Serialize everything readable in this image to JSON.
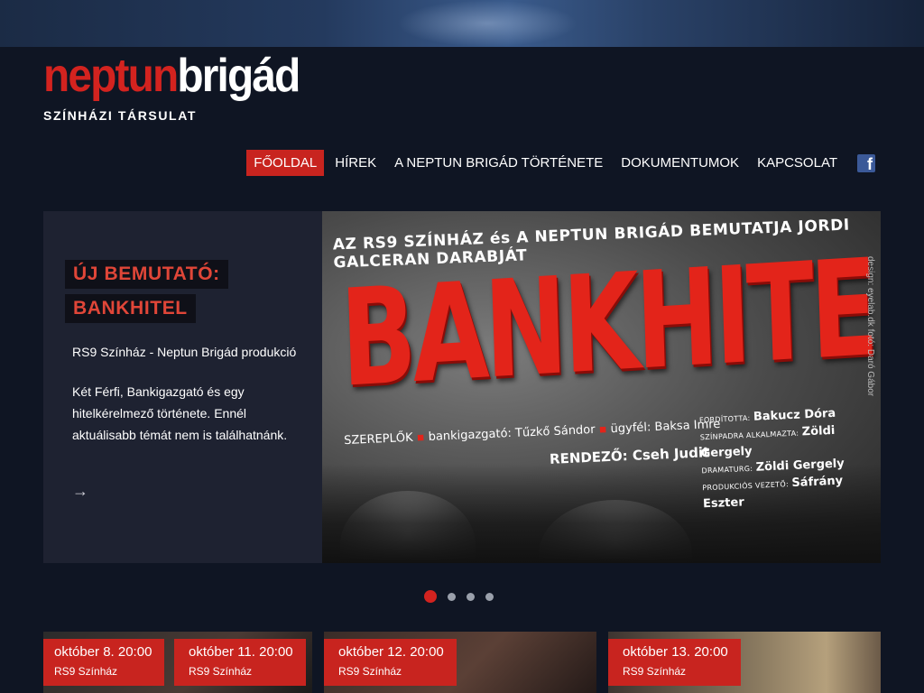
{
  "logo": {
    "part_red": "neptun",
    "part_white": "brigád",
    "tagline": "SZÍNHÁZI TÁRSULAT"
  },
  "nav": {
    "items": [
      {
        "label": "FŐOLDAL",
        "active": true
      },
      {
        "label": "HÍREK",
        "active": false
      },
      {
        "label": "A NEPTUN BRIGÁD TÖRTÉNETE",
        "active": false
      },
      {
        "label": "DOKUMENTUMOK",
        "active": false
      },
      {
        "label": "KAPCSOLAT",
        "active": false
      }
    ],
    "social_icon": "facebook-icon"
  },
  "slide": {
    "title_line1": "ÚJ BEMUTATÓ:",
    "title_line2": "BANKHITEL",
    "paragraph1": "RS9 Színház - Neptun Brigád produkció",
    "paragraph2": "Két Férfi, Bankigazgató és egy hitelkérelmező története. Ennél aktuálisabb témát nem is találhatnánk.",
    "arrow": "→",
    "poster": {
      "top_line": "AZ RS9 SZÍNHÁZ és A NEPTUN BRIGÁD BEMUTATJA JORDI GALCERAN DARABJÁT",
      "big_title": "BANKHITEL",
      "vertical_credit": "design: eyelab.dk fotó: Daró Gábor",
      "cast_label": "SZEREPLŐK",
      "cast_role1": "bankigazgató:",
      "cast_name1": "Tűzkő Sándor",
      "cast_role2": "ügyfél:",
      "cast_name2": "Baksa Imre",
      "director_label": "RENDEZŐ:",
      "director_name": "Cseh Judit",
      "credits": [
        {
          "key": "FORDÍTOTTA:",
          "value": "Bakucz Dóra"
        },
        {
          "key": "SZÍNPADRA ALKALMAZTA:",
          "value": "Zöldi Gergely"
        },
        {
          "key": "DRAMATURG:",
          "value": "Zöldi Gergely"
        },
        {
          "key": "PRODUKCIÓS VEZETŐ:",
          "value": "Sáfrány Eszter"
        }
      ]
    }
  },
  "slider_dots": {
    "count": 4,
    "active_index": 0
  },
  "events": [
    {
      "date": "október 8. 20:00",
      "venue": "RS9 Színház"
    },
    {
      "date": "október 11. 20:00",
      "venue": "RS9 Színház"
    },
    {
      "date": "október 12. 20:00",
      "venue": "RS9 Színház"
    },
    {
      "date": "október 13. 20:00",
      "venue": "RS9 Színház"
    }
  ],
  "colors": {
    "accent_red": "#c8241f",
    "page_bg": "#0f1523",
    "slide_panel_bg": "#1e2231",
    "facebook_blue": "#3b5998"
  }
}
